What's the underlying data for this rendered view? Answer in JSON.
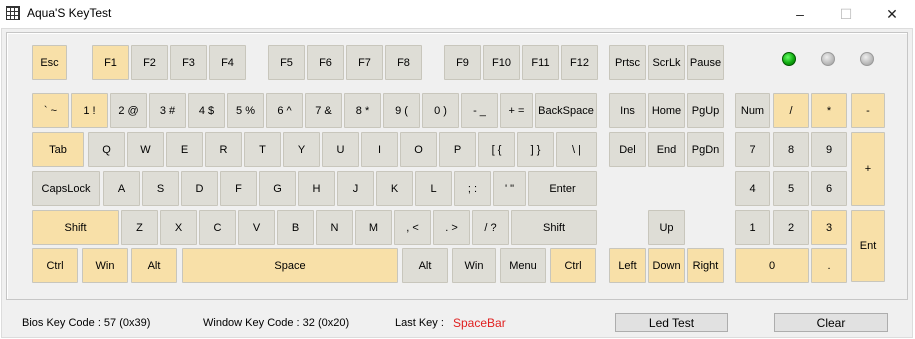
{
  "window": {
    "title": "Aqua'S KeyTest",
    "minimize": "–",
    "maximize": "☐",
    "close": "✕"
  },
  "leds": [
    {
      "name": "led-1",
      "state": "on",
      "color": "#22cc22"
    },
    {
      "name": "led-2",
      "state": "off",
      "color": "#bbbbbb"
    },
    {
      "name": "led-3",
      "state": "off",
      "color": "#bbbbbb"
    }
  ],
  "keys": {
    "esc": "Esc",
    "f1": "F1",
    "f2": "F2",
    "f3": "F3",
    "f4": "F4",
    "f5": "F5",
    "f6": "F6",
    "f7": "F7",
    "f8": "F8",
    "f9": "F9",
    "f10": "F10",
    "f11": "F11",
    "f12": "F12",
    "prtsc": "Prtsc",
    "scrlk": "ScrLk",
    "pause": "Pause",
    "backtick": "` ~",
    "1": "1 !",
    "2": "2 @",
    "3": "3 #",
    "4": "4 $",
    "5": "5 %",
    "6": "6 ^",
    "7": "7 &",
    "8": "8 *",
    "9": "9 (",
    "0": "0 )",
    "minus": "- _",
    "equals": "+ =",
    "backspace": "BackSpace",
    "ins": "Ins",
    "home": "Home",
    "pgup": "PgUp",
    "num": "Num",
    "np_slash": "/",
    "np_star": "*",
    "np_minus": "-",
    "tab": "Tab",
    "q": "Q",
    "w": "W",
    "e": "E",
    "r": "R",
    "t": "T",
    "y": "Y",
    "u": "U",
    "i": "I",
    "o": "O",
    "p": "P",
    "lbracket": "[ {",
    "rbracket": "] }",
    "backslash": "\\ |",
    "del": "Del",
    "end": "End",
    "pgdn": "PgDn",
    "np7": "7",
    "np8": "8",
    "np9": "9",
    "np_plus": "+",
    "capslock": "CapsLock",
    "a": "A",
    "s": "S",
    "d": "D",
    "f": "F",
    "g": "G",
    "h": "H",
    "j": "J",
    "k": "K",
    "l": "L",
    "semicolon": "; :",
    "quote": "' \"",
    "enter": "Enter",
    "np4": "4",
    "np5": "5",
    "np6": "6",
    "lshift": "Shift",
    "z": "Z",
    "x": "X",
    "c": "C",
    "v": "V",
    "b": "B",
    "n": "N",
    "m": "M",
    "comma": ", <",
    "period": ". >",
    "slash": "/ ?",
    "rshift": "Shift",
    "up": "Up",
    "np1": "1",
    "np2": "2",
    "np3": "3",
    "np_enter": "Ent",
    "lctrl": "Ctrl",
    "lwin": "Win",
    "lalt": "Alt",
    "space": "Space",
    "ralt": "Alt",
    "rwin": "Win",
    "menu": "Menu",
    "rctrl": "Ctrl",
    "left": "Left",
    "down": "Down",
    "right": "Right",
    "np0": "0",
    "np_dot": "."
  },
  "status": {
    "bios_label": "Bios Key Code : 57 (0x39)",
    "window_label": "Window Key Code : 32 (0x20)",
    "last_key_label": "Last Key :",
    "last_key_value": "SpaceBar"
  },
  "buttons": {
    "led_test": "Led Test",
    "clear": "Clear"
  }
}
